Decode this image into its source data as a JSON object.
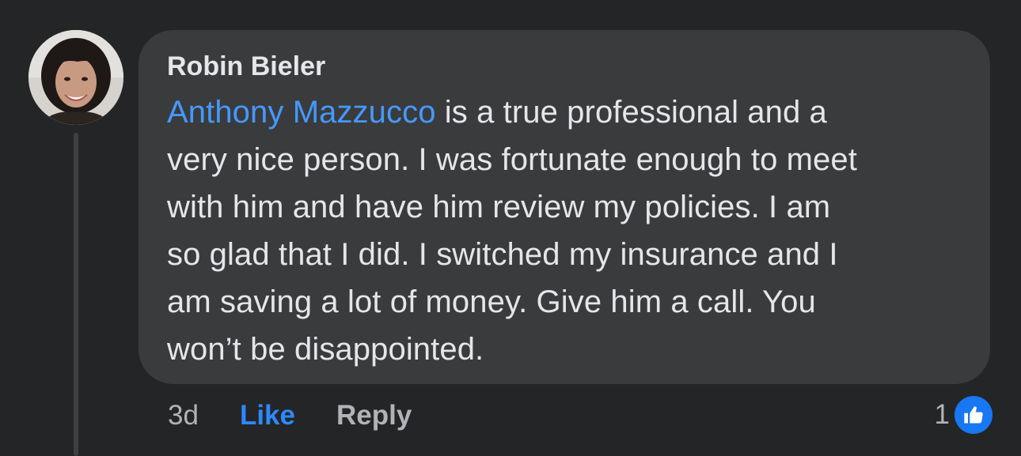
{
  "comment": {
    "author": "Robin Bieler",
    "mention": "Anthony Mazzucco",
    "text_lines": [
      " is a true professional and a",
      "very nice person. I was fortunate enough to meet",
      "with him and have him review my policies.  I am",
      "so glad that I did.  I switched my insurance and I",
      "am saving a lot of money. Give him a call.  You",
      "won’t be disappointed."
    ]
  },
  "actions": {
    "time": "3d",
    "like_label": "Like",
    "reply_label": "Reply"
  },
  "reactions": {
    "count": "1",
    "icon": "thumbs-up-icon"
  },
  "colors": {
    "background": "#242526",
    "bubble": "#3a3b3c",
    "mention": "#4599ff",
    "like_active": "#2d88ff",
    "like_badge": "#1877f2"
  }
}
